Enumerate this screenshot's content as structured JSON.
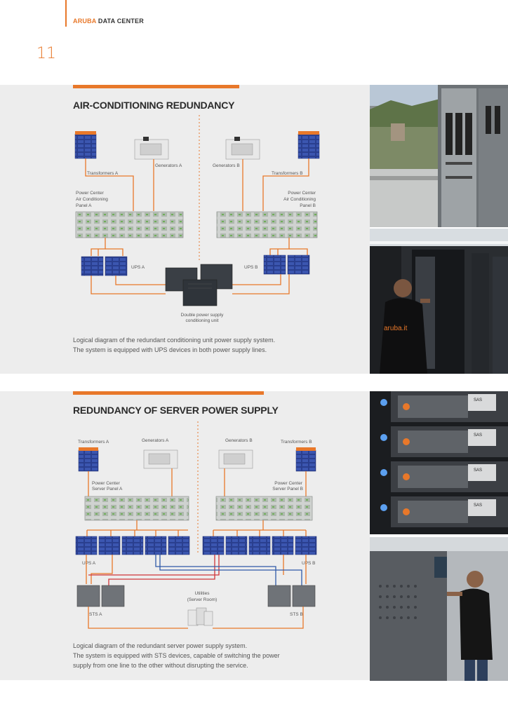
{
  "header": {
    "brand_highlight": "ARUBA",
    "brand_rest": "DATA CENTER",
    "page_number": "11"
  },
  "section1": {
    "title": "AIR-CONDITIONING REDUNDANCY",
    "labels": {
      "transformers_a": "Transformers A",
      "generators_a": "Generators A",
      "generators_b": "Generators B",
      "transformers_b": "Transformers B",
      "power_center_a_1": "Power Center",
      "power_center_a_2": "Air Conditioning",
      "power_center_a_3": "Panel A",
      "power_center_b_1": "Power Center",
      "power_center_b_2": "Air Conditioning",
      "power_center_b_3": "Panel B",
      "ups_a": "UPS A",
      "ups_b": "UPS B",
      "unit_1": "Double power supply",
      "unit_2": "conditioning unit"
    },
    "caption_line1": "Logical diagram of the redundant conditioning unit power supply system.",
    "caption_line2": "The system is equipped with UPS devices in both power supply lines."
  },
  "section2": {
    "title": "REDUNDANCY OF SERVER POWER SUPPLY",
    "labels": {
      "transformers_a": "Transformers A",
      "generators_a": "Generators A",
      "generators_b": "Generators B",
      "transformers_b": "Transformers B",
      "power_center_a_1": "Power Center",
      "power_center_a_2": "Server Panel A",
      "power_center_b_1": "Power Center",
      "power_center_b_2": "Server Panel B",
      "ups_a": "UPS A",
      "ups_b": "UPS B",
      "sts_a": "STS A",
      "sts_b": "STS B",
      "utilities_1": "Utilities",
      "utilities_2": "(Server Room)"
    },
    "caption_line1": "Logical diagram of the redundant server power supply system.",
    "caption_line2": "The system is equipped with STS devices, capable of switching the power",
    "caption_line3": "supply from one line to the other without disrupting the service."
  },
  "photos": {
    "server_label": "SAS",
    "shirt_text": "aruba.it"
  },
  "colors": {
    "accent": "#e8782a",
    "wire_orange": "#e8782a",
    "wire_red": "#d0353a",
    "wire_blue": "#2f5aa8",
    "ups_blue": "#2a3f8f"
  }
}
